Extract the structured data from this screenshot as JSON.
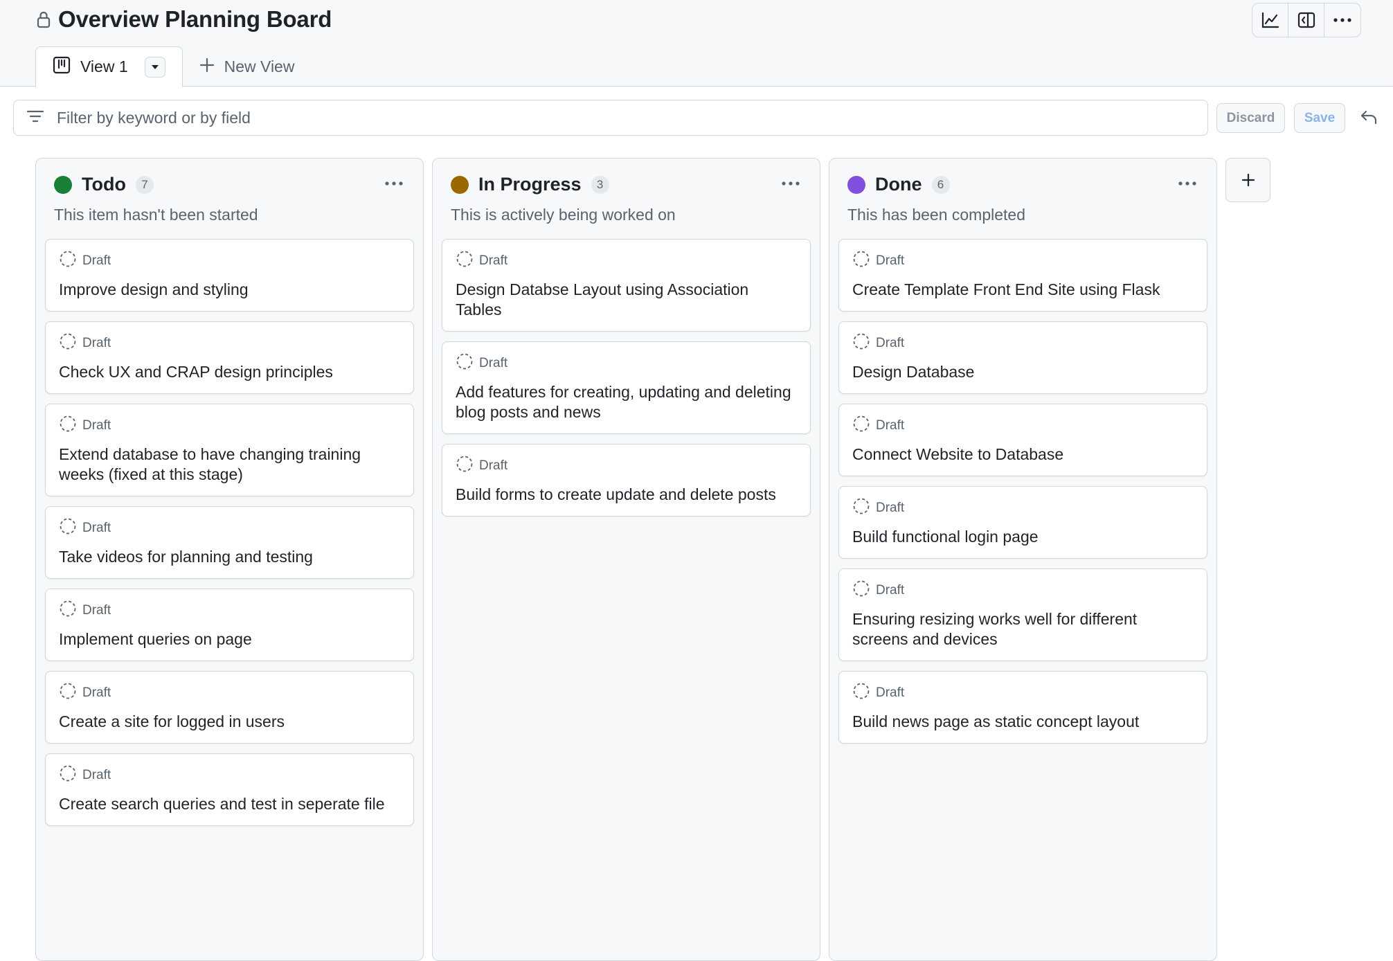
{
  "header": {
    "title": "Overview Planning Board",
    "actions": [
      {
        "name": "insights-chart-icon"
      },
      {
        "name": "side-panel-icon"
      },
      {
        "name": "more-options-icon"
      }
    ]
  },
  "tabs": {
    "active": {
      "label": "View 1",
      "icon": "board-icon"
    },
    "new_view_label": "New View"
  },
  "filter": {
    "placeholder": "Filter by keyword or by field",
    "discard_label": "Discard",
    "save_label": "Save"
  },
  "columns": [
    {
      "name": "Todo",
      "count": "7",
      "color": "#1a7f37",
      "description": "This item hasn't been started",
      "cards": [
        {
          "type": "Draft",
          "title": "Improve design and styling"
        },
        {
          "type": "Draft",
          "title": "Check UX and CRAP design principles"
        },
        {
          "type": "Draft",
          "title": "Extend database to have changing training weeks (fixed at this stage)"
        },
        {
          "type": "Draft",
          "title": "Take videos for planning and testing"
        },
        {
          "type": "Draft",
          "title": "Implement queries on page"
        },
        {
          "type": "Draft",
          "title": "Create a site for logged in users"
        },
        {
          "type": "Draft",
          "title": "Create search queries and test in seperate file"
        }
      ]
    },
    {
      "name": "In Progress",
      "count": "3",
      "color": "#9a6700",
      "description": "This is actively being worked on",
      "cards": [
        {
          "type": "Draft",
          "title": "Design Databse Layout using Association Tables"
        },
        {
          "type": "Draft",
          "title": "Add features for creating, updating and deleting blog posts and news"
        },
        {
          "type": "Draft",
          "title": "Build forms to create update and delete posts"
        }
      ]
    },
    {
      "name": "Done",
      "count": "6",
      "color": "#8250df",
      "description": "This has been completed",
      "cards": [
        {
          "type": "Draft",
          "title": "Create Template Front End Site using Flask"
        },
        {
          "type": "Draft",
          "title": "Design Database"
        },
        {
          "type": "Draft",
          "title": "Connect Website to Database"
        },
        {
          "type": "Draft",
          "title": "Build functional login page"
        },
        {
          "type": "Draft",
          "title": "Ensuring resizing works well for different screens and devices"
        },
        {
          "type": "Draft",
          "title": "Build news page as static concept layout"
        }
      ]
    }
  ]
}
